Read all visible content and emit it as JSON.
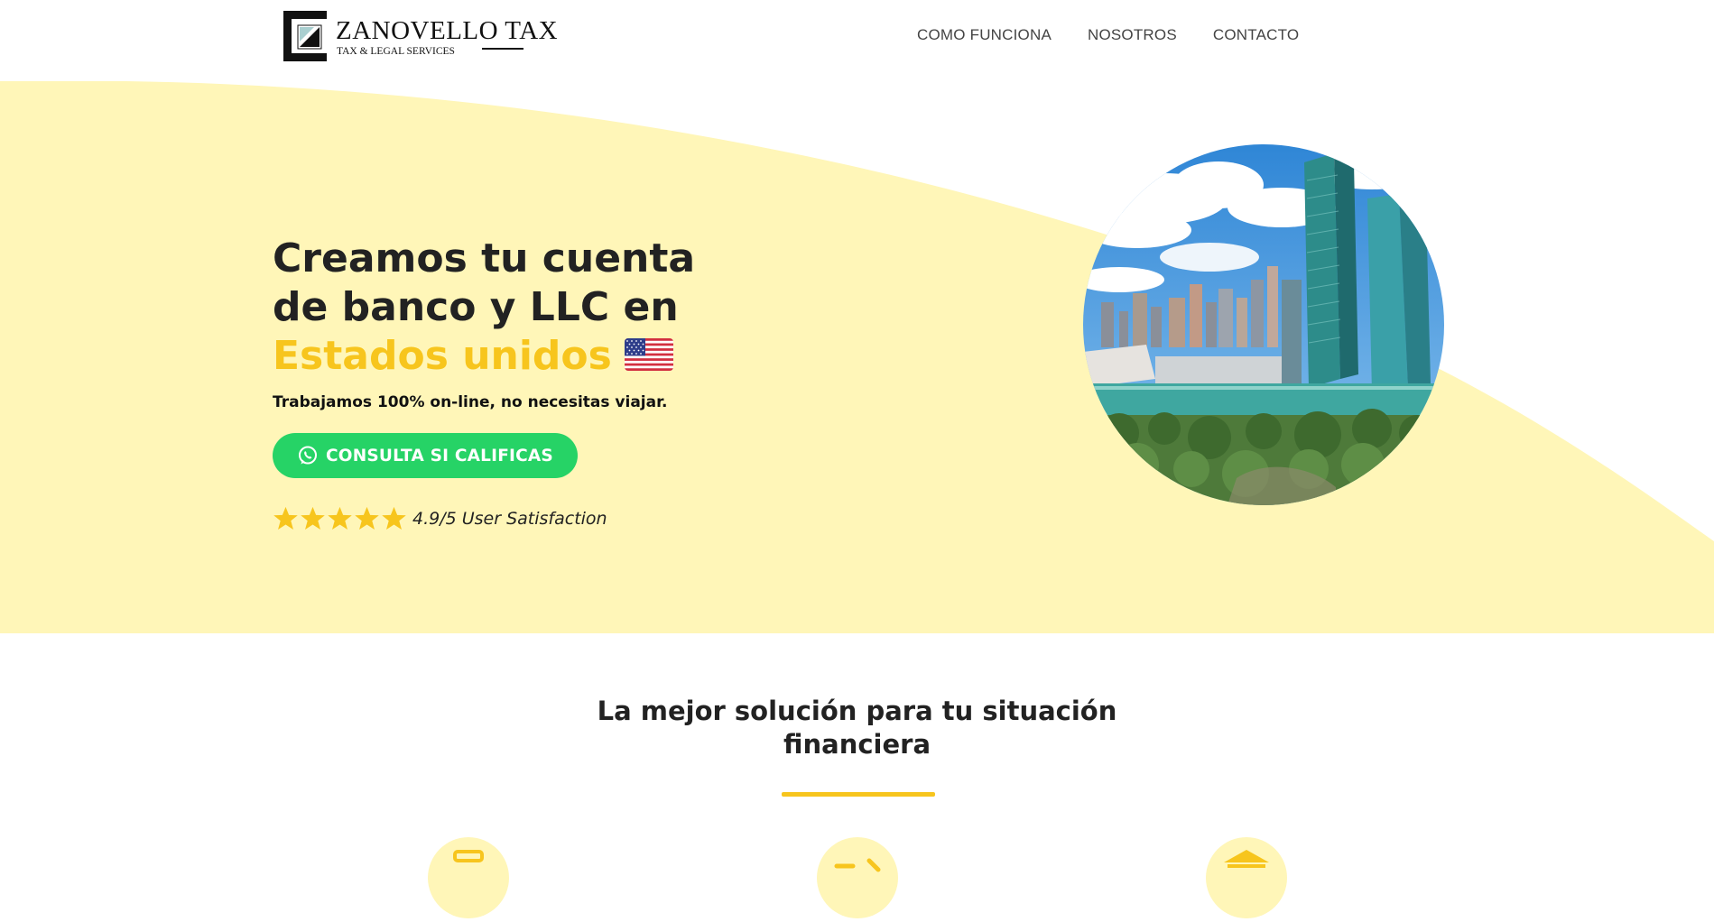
{
  "brand": {
    "name": "ZANOVELLO TAX",
    "tagline": "TAX & LEGAL SERVICES"
  },
  "nav": {
    "items": [
      {
        "label": "COMO FUNCIONA"
      },
      {
        "label": "NOSOTROS"
      },
      {
        "label": "CONTACTO"
      }
    ]
  },
  "hero": {
    "title_line1": "Creamos tu cuenta",
    "title_line2": "de banco y LLC en",
    "title_accent": "Estados unidos",
    "subtitle": "Trabajamos 100% on-line, no necesitas viajar.",
    "cta_label": "CONSULTA SI CALIFICAS",
    "cta_icon": "whatsapp-icon",
    "rating_stars": 5,
    "rating_text": "4.9/5 User Satisfaction"
  },
  "section": {
    "title_line1": "La mejor solución para tu situación",
    "title_line2": "financiera"
  },
  "colors": {
    "hero_background": "#fff6b8",
    "accent": "#f7c51d",
    "cta": "#26d366",
    "text": "#222222"
  }
}
